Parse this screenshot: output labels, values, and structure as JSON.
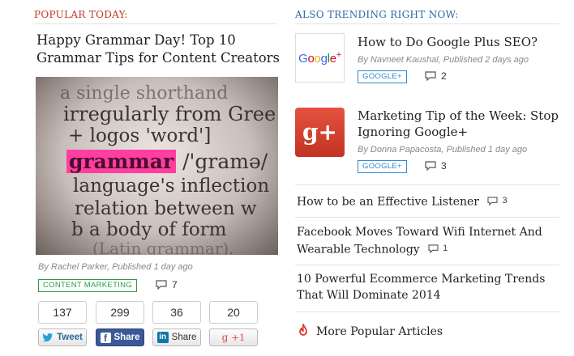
{
  "popular": {
    "heading": "POPULAR TODAY:",
    "title": "Happy Grammar Day! Top 10 Grammar Tips for Content Creators",
    "image_text": {
      "line1": "a  single   shorthand",
      "line2": "irregularly from Gree",
      "line3": "+ logos 'word']",
      "highlight": "grammar",
      "line4_rest": " /'gramə/",
      "line5": "language's inflection",
      "line6": "relation between w",
      "line7": "b  a body of form",
      "line8": "(Latin grammar)."
    },
    "meta": "By Rachel Parker, Published 1 day ago",
    "tag": "CONTENT MARKETING",
    "comments": "7",
    "share_counts": [
      "137",
      "299",
      "36",
      "20"
    ],
    "share_buttons": {
      "twitter": "Tweet",
      "facebook": "Share",
      "linkedin": "Share",
      "gplus": "+1"
    }
  },
  "trending": {
    "heading": "ALSO TRENDING RIGHT NOW:",
    "featured": [
      {
        "title": "How to Do Google Plus SEO?",
        "meta": "By Navneet Kaushal, Published 2 days ago",
        "tag": "GOOGLE+",
        "comments": "2",
        "thumb_text": "Google+"
      },
      {
        "title": "Marketing Tip of the Week: Stop Ignoring Google+",
        "meta": "By Donna Papacosta, Published 1 day ago",
        "tag": "GOOGLE+",
        "comments": "3",
        "thumb_text": "g+"
      }
    ],
    "list": [
      {
        "title": "How to be an Effective Listener",
        "comments": "3"
      },
      {
        "title": "Facebook Moves Toward Wifi Internet And Wearable Technology",
        "comments": "1"
      },
      {
        "title": "10 Powerful Ecommerce Marketing Trends That Will Dominate 2014"
      }
    ],
    "more": "More Popular Articles"
  },
  "colors": {
    "popular_heading": "#c0392b",
    "trending_heading": "#2b6aa3",
    "twitter": "#2a9fd8",
    "facebook": "#3b5998",
    "linkedin": "#0e76a8",
    "gplus": "#dd4b39",
    "tag_green": "#2e9a4a",
    "tag_blue": "#2b8bc9"
  }
}
